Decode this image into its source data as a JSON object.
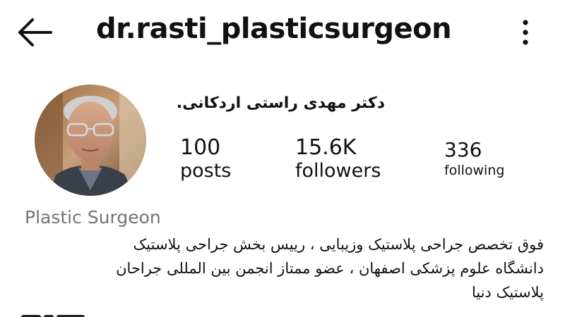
{
  "header": {
    "username": "dr.rasti_plasticsurgeon",
    "back_icon": "arrow-left-icon",
    "more_icon": "more-vertical-icon"
  },
  "profile": {
    "display_name": "دکتر مهدی راستی اردکانی.",
    "avatar_icon": "profile-photo",
    "stats": {
      "posts": {
        "value": "100",
        "label": "posts"
      },
      "followers": {
        "value": "15.6K",
        "label": "followers"
      },
      "following": {
        "value": "336",
        "label": "following"
      }
    },
    "category": "Plastic Surgeon",
    "bio_lines": [
      "فوق تخصص جراحی پلاستیک وزیبایی ، رییس بخش جراحی پلاستیک",
      "دانشگاه علوم پزشکی اصفهان ، عضو ممتاز انجمن بین المللی جراحان",
      "پلاستیک  دنیا"
    ]
  },
  "colors": {
    "text": "#111111",
    "category": "#737373",
    "background": "#ffffff"
  }
}
